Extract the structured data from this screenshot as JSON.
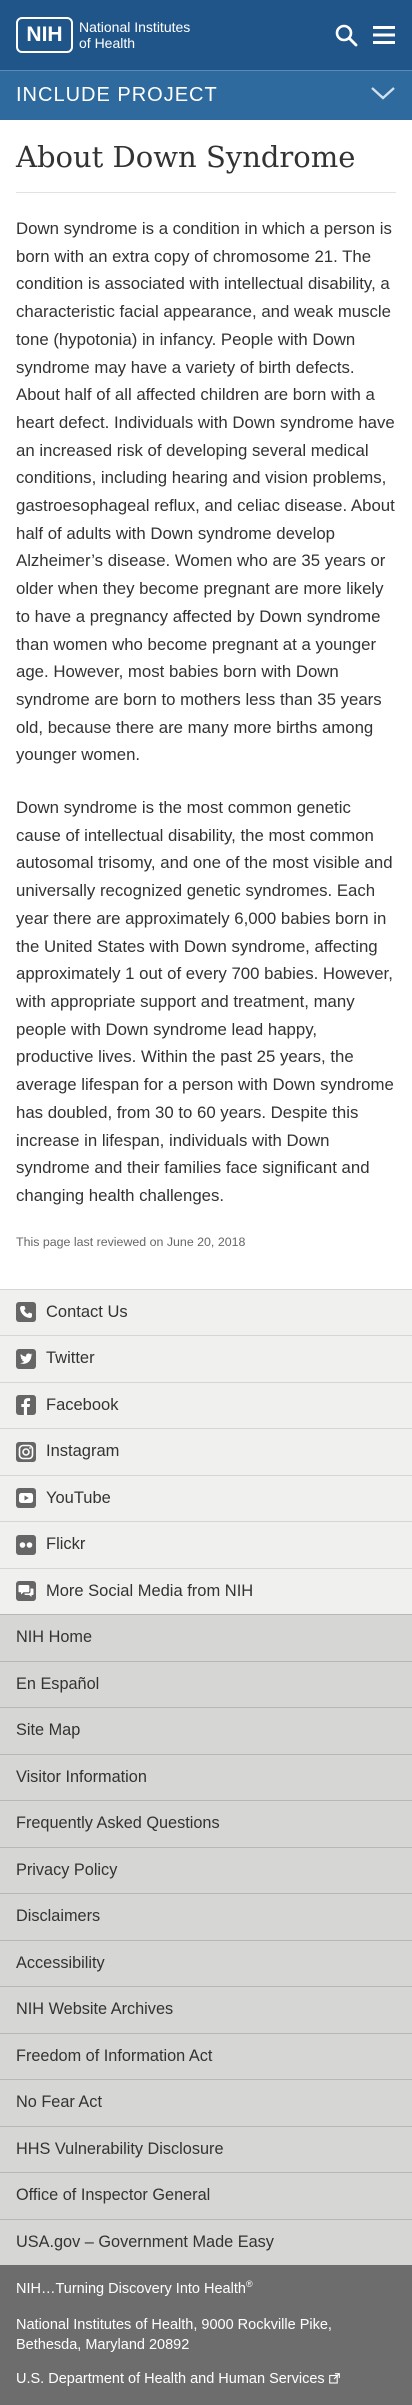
{
  "header": {
    "logo_mark": "NIH",
    "logo_line1": "National Institutes",
    "logo_line2": "of Health",
    "search_icon": "search-icon",
    "menu_icon": "hamburger-menu-icon"
  },
  "project_bar": {
    "label": "INCLUDE PROJECT",
    "toggle_icon": "chevron-down-icon"
  },
  "main": {
    "title": "About Down Syndrome",
    "paragraphs": [
      "Down syndrome is a condition in which a person is born with an extra copy of chromosome 21.  The condition is associated with intellectual disability, a characteristic facial appearance, and weak muscle tone (hypotonia) in infancy.  People with Down syndrome may have a variety of birth defects. About half of all affected children are born with a heart defect.  Individuals with Down syndrome have an increased risk of developing several medical conditions, including hearing and vision problems, gastroesophageal reflux, and celiac disease.  About half of adults with Down syndrome develop Alzheimer’s disease.  Women who are 35 years or older when they become pregnant are more likely to have a pregnancy affected by Down syndrome than women who become pregnant at a younger age. However, most babies born with Down syndrome are born to mothers less than 35 years old, because there are many more births among younger women.",
      "Down syndrome is the most common genetic cause of intellectual disability, the most common autosomal trisomy, and one of the most visible and universally recognized genetic syndromes. Each year there are approximately 6,000 babies born in the United States with Down syndrome, affecting approximately 1 out of every 700 babies. However, with appropriate support and treatment, many people with Down syndrome lead happy, productive lives. Within the past 25 years, the average lifespan for a person with Down syndrome has doubled, from 30 to 60 years.  Despite this increase in lifespan, individuals with Down syndrome and their families face significant and changing health challenges."
    ],
    "reviewed": "This page last reviewed on June 20, 2018"
  },
  "social": [
    {
      "label": "Contact Us",
      "icon": "phone-icon"
    },
    {
      "label": "Twitter",
      "icon": "twitter-icon"
    },
    {
      "label": "Facebook",
      "icon": "facebook-icon"
    },
    {
      "label": "Instagram",
      "icon": "instagram-icon"
    },
    {
      "label": "YouTube",
      "icon": "youtube-icon"
    },
    {
      "label": "Flickr",
      "icon": "flickr-icon"
    },
    {
      "label": "More Social Media from NIH",
      "icon": "chat-bubbles-icon"
    }
  ],
  "footer_links": [
    "NIH Home",
    "En Español",
    "Site Map",
    "Visitor Information",
    "Frequently Asked Questions",
    "Privacy Policy",
    "Disclaimers",
    "Accessibility",
    "NIH Website Archives",
    "Freedom of Information Act",
    "No Fear Act",
    "HHS Vulnerability Disclosure",
    "Office of Inspector General",
    "USA.gov – Government Made Easy"
  ],
  "bottom": {
    "tagline": "NIH…Turning Discovery Into Health",
    "tagline_mark": "®",
    "address_line1": "National Institutes of Health, 9000 Rockville Pike,",
    "address_line2": "Bethesda, Maryland 20892",
    "hhs_link": "U.S. Department of Health and Human Services",
    "external_icon": "external-link-icon"
  },
  "colors": {
    "header_bg": "#20558a",
    "project_bar_bg": "#2e6a9e",
    "social_bg": "#f0f0ee",
    "footer_links_bg": "#d6d6d4",
    "bottom_bg": "#6d6d6d"
  }
}
